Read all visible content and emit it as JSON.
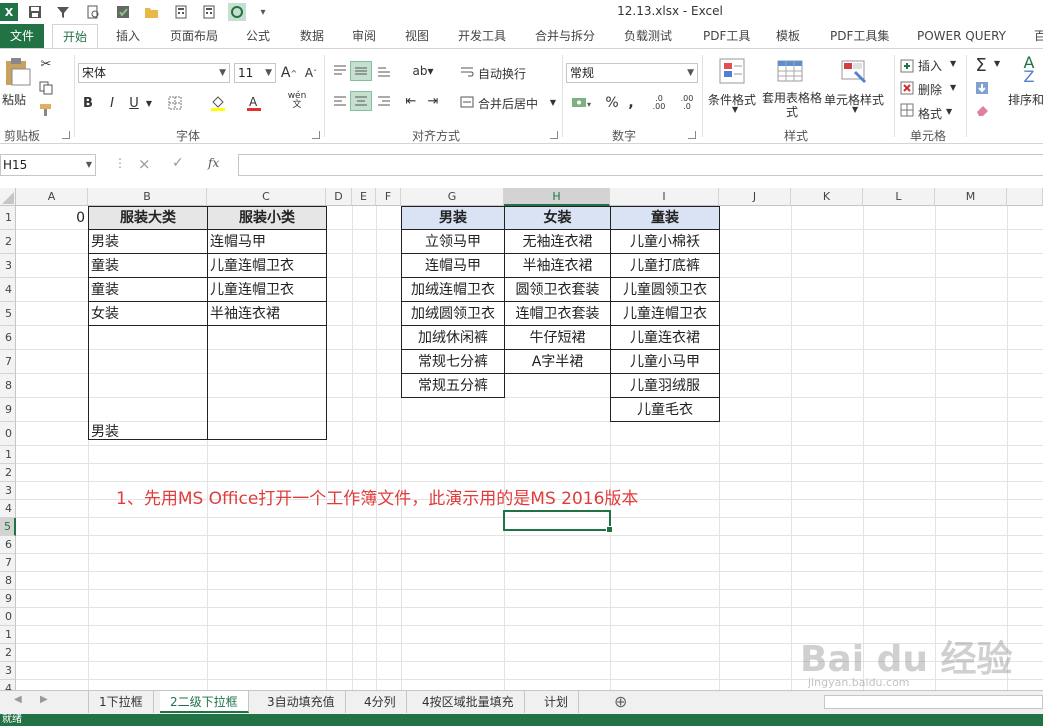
{
  "window": {
    "title": "12.13.xlsx - Excel"
  },
  "quick_access": [
    "excel-logo-icon",
    "save-icon",
    "filter-icon",
    "print-preview-icon",
    "save-check-icon",
    "folder-icon",
    "calculator-icon",
    "sync-icon",
    "customize-icon"
  ],
  "tabs": [
    "文件",
    "开始",
    "插入",
    "页面布局",
    "公式",
    "数据",
    "审阅",
    "视图",
    "开发工具",
    "合并与拆分",
    "负载测试",
    "PDF工具",
    "模板",
    "PDF工具集",
    "POWER QUERY",
    "百"
  ],
  "ribbon": {
    "clipboard": {
      "label": "剪贴板",
      "paste": "粘贴"
    },
    "font": {
      "label": "字体",
      "name": "宋体",
      "size": "11",
      "bold": "B",
      "italic": "I",
      "underline": "U",
      "phonetic": "wén"
    },
    "alignment": {
      "label": "对齐方式",
      "wrap": "自动换行",
      "merge": "合并后居中"
    },
    "number": {
      "label": "数字",
      "format": "常规",
      "percent": "%",
      "comma": ","
    },
    "styles": {
      "label": "样式",
      "conditional": "条件格式",
      "table": "套用表格格式",
      "cell_styles": "单元格样式"
    },
    "cells": {
      "label": "单元格",
      "insert": "插入",
      "delete": "删除",
      "format": "格式"
    },
    "editing": {
      "sort": "排序和"
    }
  },
  "formula_bar": {
    "name_box": "H15",
    "fx": "fx",
    "cancel": "×",
    "enter": "✓"
  },
  "columns": [
    "A",
    "B",
    "C",
    "D",
    "E",
    "F",
    "G",
    "H",
    "I",
    "J",
    "K",
    "L",
    "M"
  ],
  "rows": [
    "1",
    "2",
    "3",
    "4",
    "5",
    "6",
    "7",
    "8",
    "9",
    "0",
    "1",
    "2",
    "3",
    "4",
    "5",
    "6",
    "7",
    "8",
    "9",
    "0",
    "1",
    "2",
    "3",
    "4"
  ],
  "table1": {
    "a1": "0",
    "headers": [
      "服装大类",
      "服装小类"
    ],
    "rows": [
      [
        "男装",
        "连帽马甲"
      ],
      [
        "童装",
        "儿童连帽卫衣"
      ],
      [
        "童装",
        "儿童连帽卫衣"
      ],
      [
        "女装",
        "半袖连衣裙"
      ]
    ],
    "b10": "男装"
  },
  "table2": {
    "headers": [
      "男装",
      "女装",
      "童装"
    ],
    "men": [
      "立领马甲",
      "连帽马甲",
      "加绒连帽卫衣",
      "加绒圆领卫衣",
      "加绒休闲裤",
      "常规七分裤",
      "常规五分裤"
    ],
    "women": [
      "无袖连衣裙",
      "半袖连衣裙",
      "圆领卫衣套装",
      "连帽卫衣套装",
      "牛仔短裙",
      "A字半裙"
    ],
    "kids": [
      "儿童小棉袄",
      "儿童打底裤",
      "儿童圆领卫衣",
      "儿童连帽卫衣",
      "儿童连衣裙",
      "儿童小马甲",
      "儿童羽绒服",
      "儿童毛衣"
    ]
  },
  "annotation": "1、先用MS Office打开一个工作簿文件，此演示用的是MS 2016版本",
  "sheets": [
    "1下拉框",
    "2二级下拉框",
    "3自动填充值",
    "4分列",
    "4按区域批量填充",
    "计划"
  ],
  "active_sheet": "2二级下拉框",
  "status": "就绪",
  "watermark": {
    "brand": "Bai du 经验",
    "url": "jingyan.baidu.com"
  },
  "colors": {
    "accent": "#217346",
    "annotation": "#e03c3c",
    "header_gray": "#e6e6e6",
    "header_blue": "#dae3f3"
  }
}
